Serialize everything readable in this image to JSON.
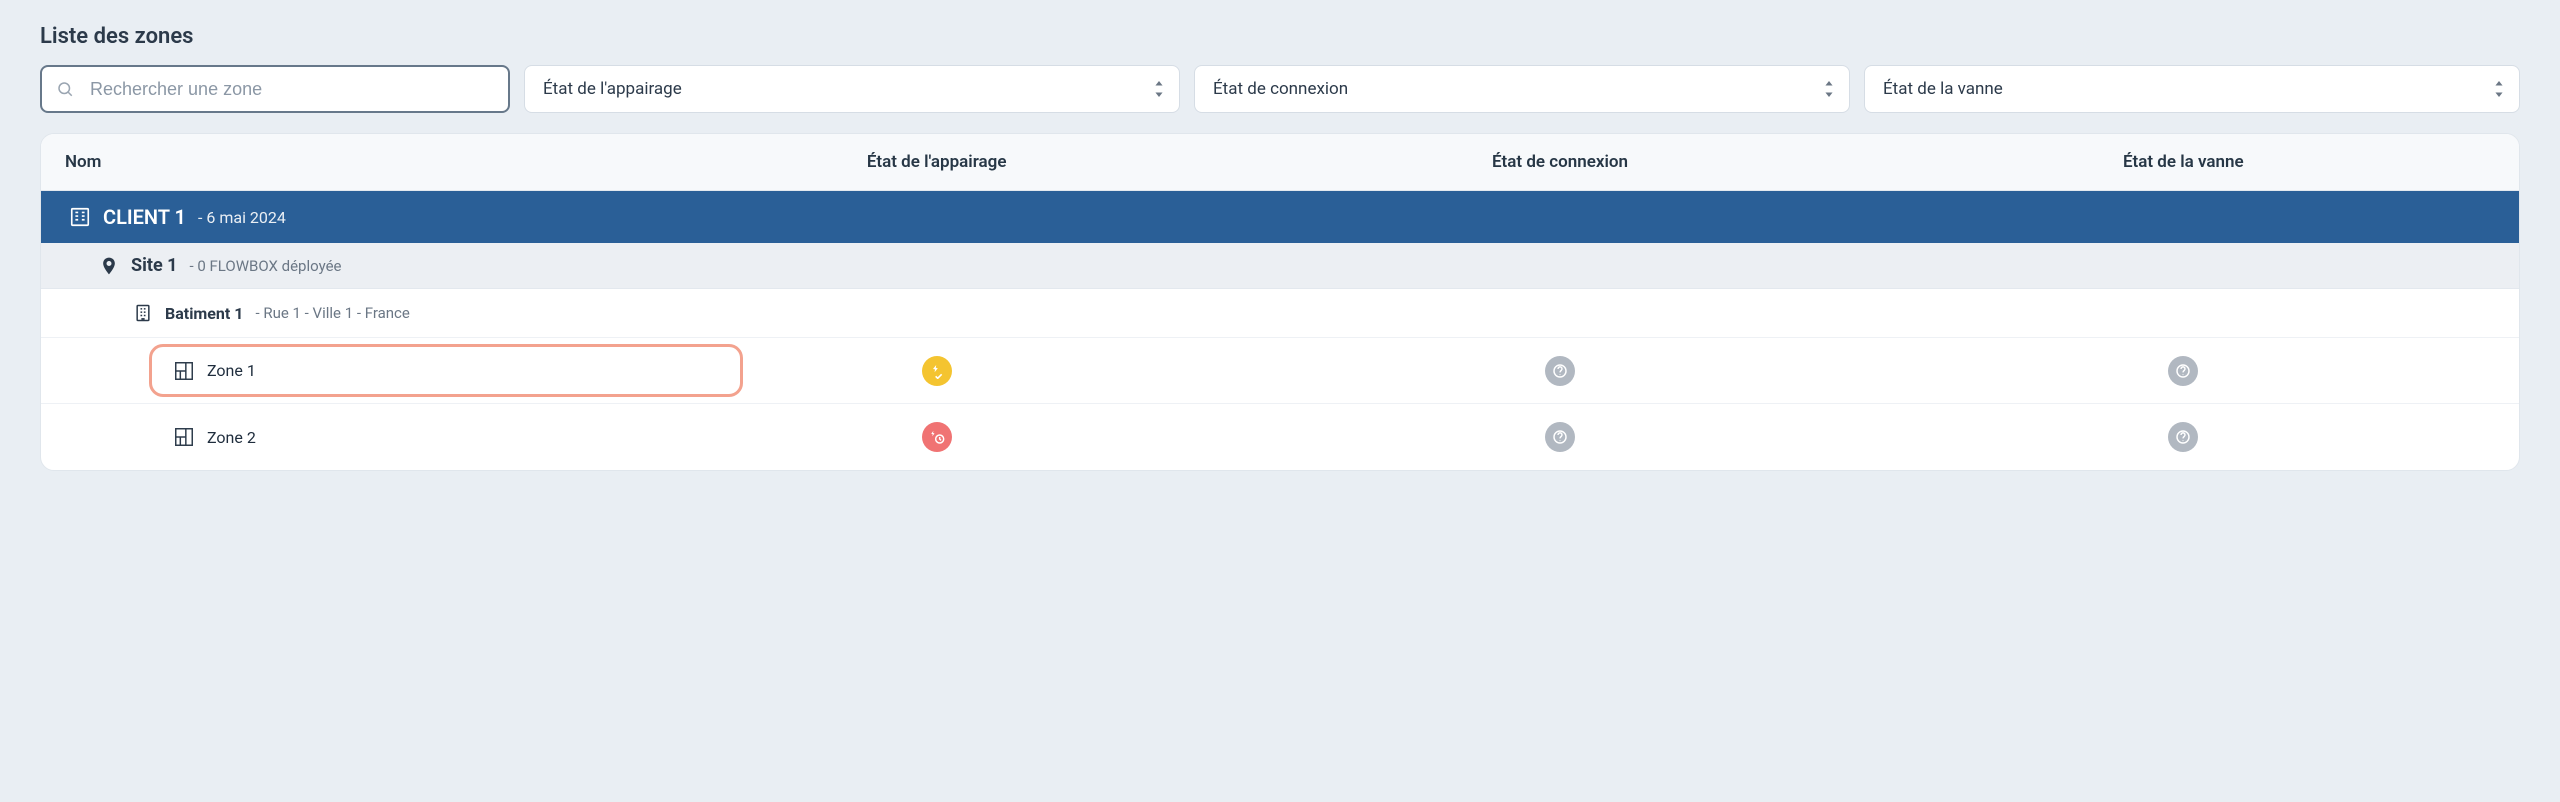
{
  "title": "Liste des zones",
  "search": {
    "placeholder": "Rechercher une zone"
  },
  "filters": {
    "pairing": "État de l'appairage",
    "connection": "État de connexion",
    "valve": "État de la vanne"
  },
  "columns": {
    "name": "Nom",
    "pairing": "État de l'appairage",
    "connection": "État de connexion",
    "valve": "État de la vanne"
  },
  "client": {
    "name": "CLIENT 1",
    "meta": "- 6 mai 2024"
  },
  "site": {
    "name": "Site 1",
    "meta": "- 0 FLOWBOX déployée"
  },
  "building": {
    "name": "Batiment 1",
    "meta": "- Rue 1 - Ville 1 - France"
  },
  "zones": [
    {
      "name": "Zone 1",
      "pairing": "in-progress",
      "connection": "unknown",
      "valve": "unknown",
      "highlighted": true
    },
    {
      "name": "Zone 2",
      "pairing": "pending",
      "connection": "unknown",
      "valve": "unknown",
      "highlighted": false
    }
  ]
}
